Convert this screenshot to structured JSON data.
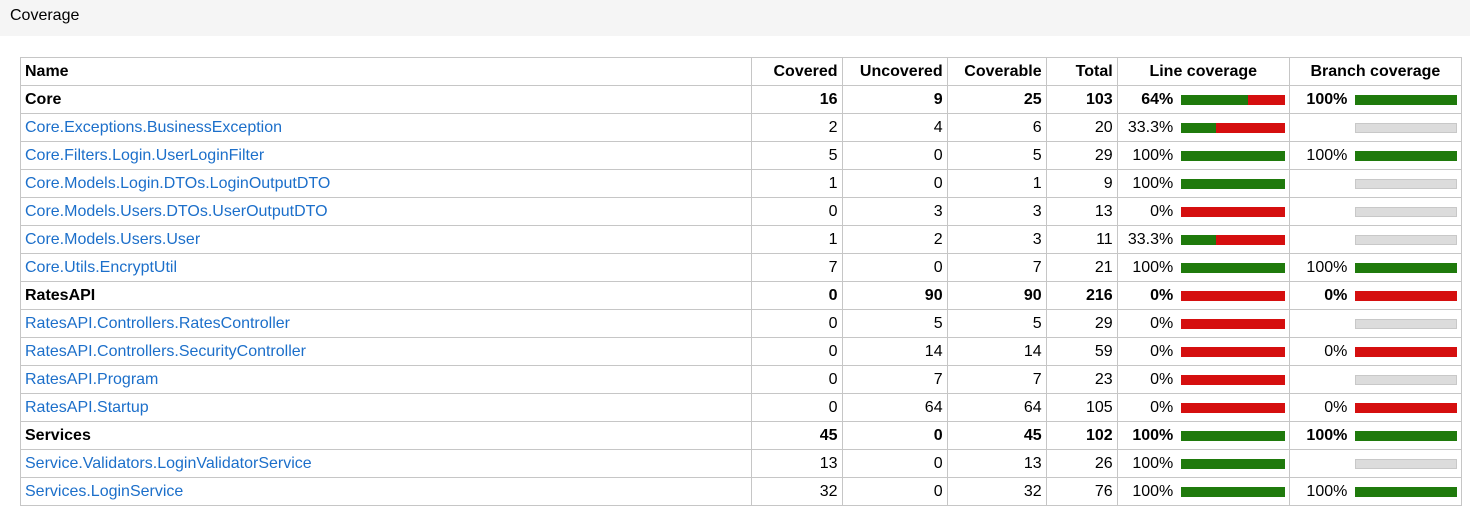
{
  "title": "Coverage",
  "columns": {
    "name": "Name",
    "covered": "Covered",
    "uncovered": "Uncovered",
    "coverable": "Coverable",
    "total": "Total",
    "line": "Line coverage",
    "branch": "Branch coverage"
  },
  "colors": {
    "covered": "#1f7a0c",
    "uncovered": "#d50f0f",
    "na": "#dcdcdc",
    "link": "#1c6fca"
  },
  "rows": [
    {
      "group": true,
      "name": "Core",
      "covered": "16",
      "uncovered": "9",
      "coverable": "25",
      "total": "103",
      "line_pct": "64%",
      "line_fraction": 0.64,
      "branch_pct": "100%",
      "branch_fraction": 1.0
    },
    {
      "group": false,
      "name": "Core.Exceptions.BusinessException",
      "covered": "2",
      "uncovered": "4",
      "coverable": "6",
      "total": "20",
      "line_pct": "33.3%",
      "line_fraction": 0.333,
      "branch_pct": "",
      "branch_fraction": null
    },
    {
      "group": false,
      "name": "Core.Filters.Login.UserLoginFilter",
      "covered": "5",
      "uncovered": "0",
      "coverable": "5",
      "total": "29",
      "line_pct": "100%",
      "line_fraction": 1.0,
      "branch_pct": "100%",
      "branch_fraction": 1.0
    },
    {
      "group": false,
      "name": "Core.Models.Login.DTOs.LoginOutputDTO",
      "covered": "1",
      "uncovered": "0",
      "coverable": "1",
      "total": "9",
      "line_pct": "100%",
      "line_fraction": 1.0,
      "branch_pct": "",
      "branch_fraction": null
    },
    {
      "group": false,
      "name": "Core.Models.Users.DTOs.UserOutputDTO",
      "covered": "0",
      "uncovered": "3",
      "coverable": "3",
      "total": "13",
      "line_pct": "0%",
      "line_fraction": 0.0,
      "branch_pct": "",
      "branch_fraction": null
    },
    {
      "group": false,
      "name": "Core.Models.Users.User",
      "covered": "1",
      "uncovered": "2",
      "coverable": "3",
      "total": "11",
      "line_pct": "33.3%",
      "line_fraction": 0.333,
      "branch_pct": "",
      "branch_fraction": null
    },
    {
      "group": false,
      "name": "Core.Utils.EncryptUtil",
      "covered": "7",
      "uncovered": "0",
      "coverable": "7",
      "total": "21",
      "line_pct": "100%",
      "line_fraction": 1.0,
      "branch_pct": "100%",
      "branch_fraction": 1.0
    },
    {
      "group": true,
      "name": "RatesAPI",
      "covered": "0",
      "uncovered": "90",
      "coverable": "90",
      "total": "216",
      "line_pct": "0%",
      "line_fraction": 0.0,
      "branch_pct": "0%",
      "branch_fraction": 0.0
    },
    {
      "group": false,
      "name": "RatesAPI.Controllers.RatesController",
      "covered": "0",
      "uncovered": "5",
      "coverable": "5",
      "total": "29",
      "line_pct": "0%",
      "line_fraction": 0.0,
      "branch_pct": "",
      "branch_fraction": null
    },
    {
      "group": false,
      "name": "RatesAPI.Controllers.SecurityController",
      "covered": "0",
      "uncovered": "14",
      "coverable": "14",
      "total": "59",
      "line_pct": "0%",
      "line_fraction": 0.0,
      "branch_pct": "0%",
      "branch_fraction": 0.0
    },
    {
      "group": false,
      "name": "RatesAPI.Program",
      "covered": "0",
      "uncovered": "7",
      "coverable": "7",
      "total": "23",
      "line_pct": "0%",
      "line_fraction": 0.0,
      "branch_pct": "",
      "branch_fraction": null
    },
    {
      "group": false,
      "name": "RatesAPI.Startup",
      "covered": "0",
      "uncovered": "64",
      "coverable": "64",
      "total": "105",
      "line_pct": "0%",
      "line_fraction": 0.0,
      "branch_pct": "0%",
      "branch_fraction": 0.0
    },
    {
      "group": true,
      "name": "Services",
      "covered": "45",
      "uncovered": "0",
      "coverable": "45",
      "total": "102",
      "line_pct": "100%",
      "line_fraction": 1.0,
      "branch_pct": "100%",
      "branch_fraction": 1.0
    },
    {
      "group": false,
      "name": "Service.Validators.LoginValidatorService",
      "covered": "13",
      "uncovered": "0",
      "coverable": "13",
      "total": "26",
      "line_pct": "100%",
      "line_fraction": 1.0,
      "branch_pct": "",
      "branch_fraction": null
    },
    {
      "group": false,
      "name": "Services.LoginService",
      "covered": "32",
      "uncovered": "0",
      "coverable": "32",
      "total": "76",
      "line_pct": "100%",
      "line_fraction": 1.0,
      "branch_pct": "100%",
      "branch_fraction": 1.0
    }
  ]
}
